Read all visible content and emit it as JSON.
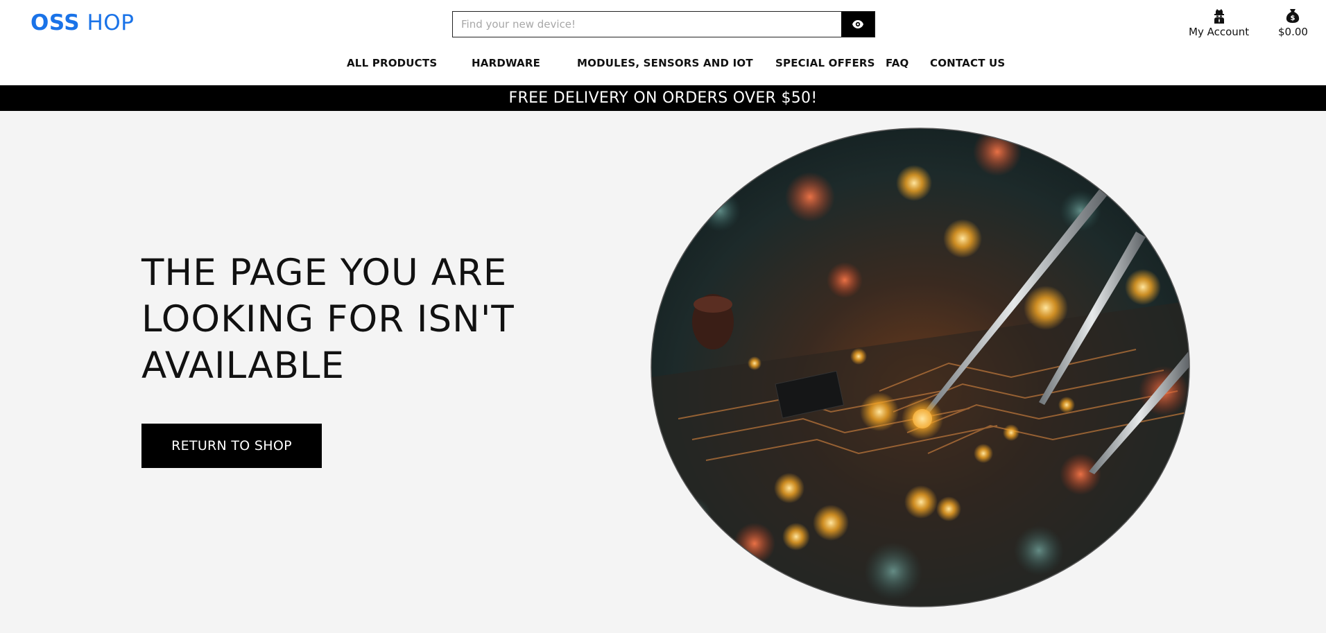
{
  "header": {
    "logo": {
      "part1": "OSS",
      "part2": "HOP"
    },
    "search": {
      "placeholder": "Find your new device!",
      "value": "",
      "button_icon": "eye-icon"
    },
    "account": {
      "label": "My Account",
      "icon": "account-icon"
    },
    "cart": {
      "total": "$0.00",
      "icon": "money-bag-icon"
    }
  },
  "nav": {
    "items": [
      {
        "label": "ALL PRODUCTS"
      },
      {
        "label": "HARDWARE"
      },
      {
        "label": "MODULES, SENSORS AND IOT"
      },
      {
        "label": "SPECIAL OFFERS"
      },
      {
        "label": "FAQ"
      },
      {
        "label": "CONTACT US"
      }
    ]
  },
  "promo": {
    "text": "FREE DELIVERY ON ORDERS OVER $50!"
  },
  "main": {
    "headline": "THE PAGE YOU ARE LOOKING FOR ISN'T AVAILABLE",
    "return_button": "RETURN TO SHOP",
    "hero_image": "circuit-board-image"
  },
  "colors": {
    "brand": "#1a73e8",
    "promo_bg": "#000000",
    "main_bg": "#f4f4f4",
    "button_bg": "#000000"
  }
}
